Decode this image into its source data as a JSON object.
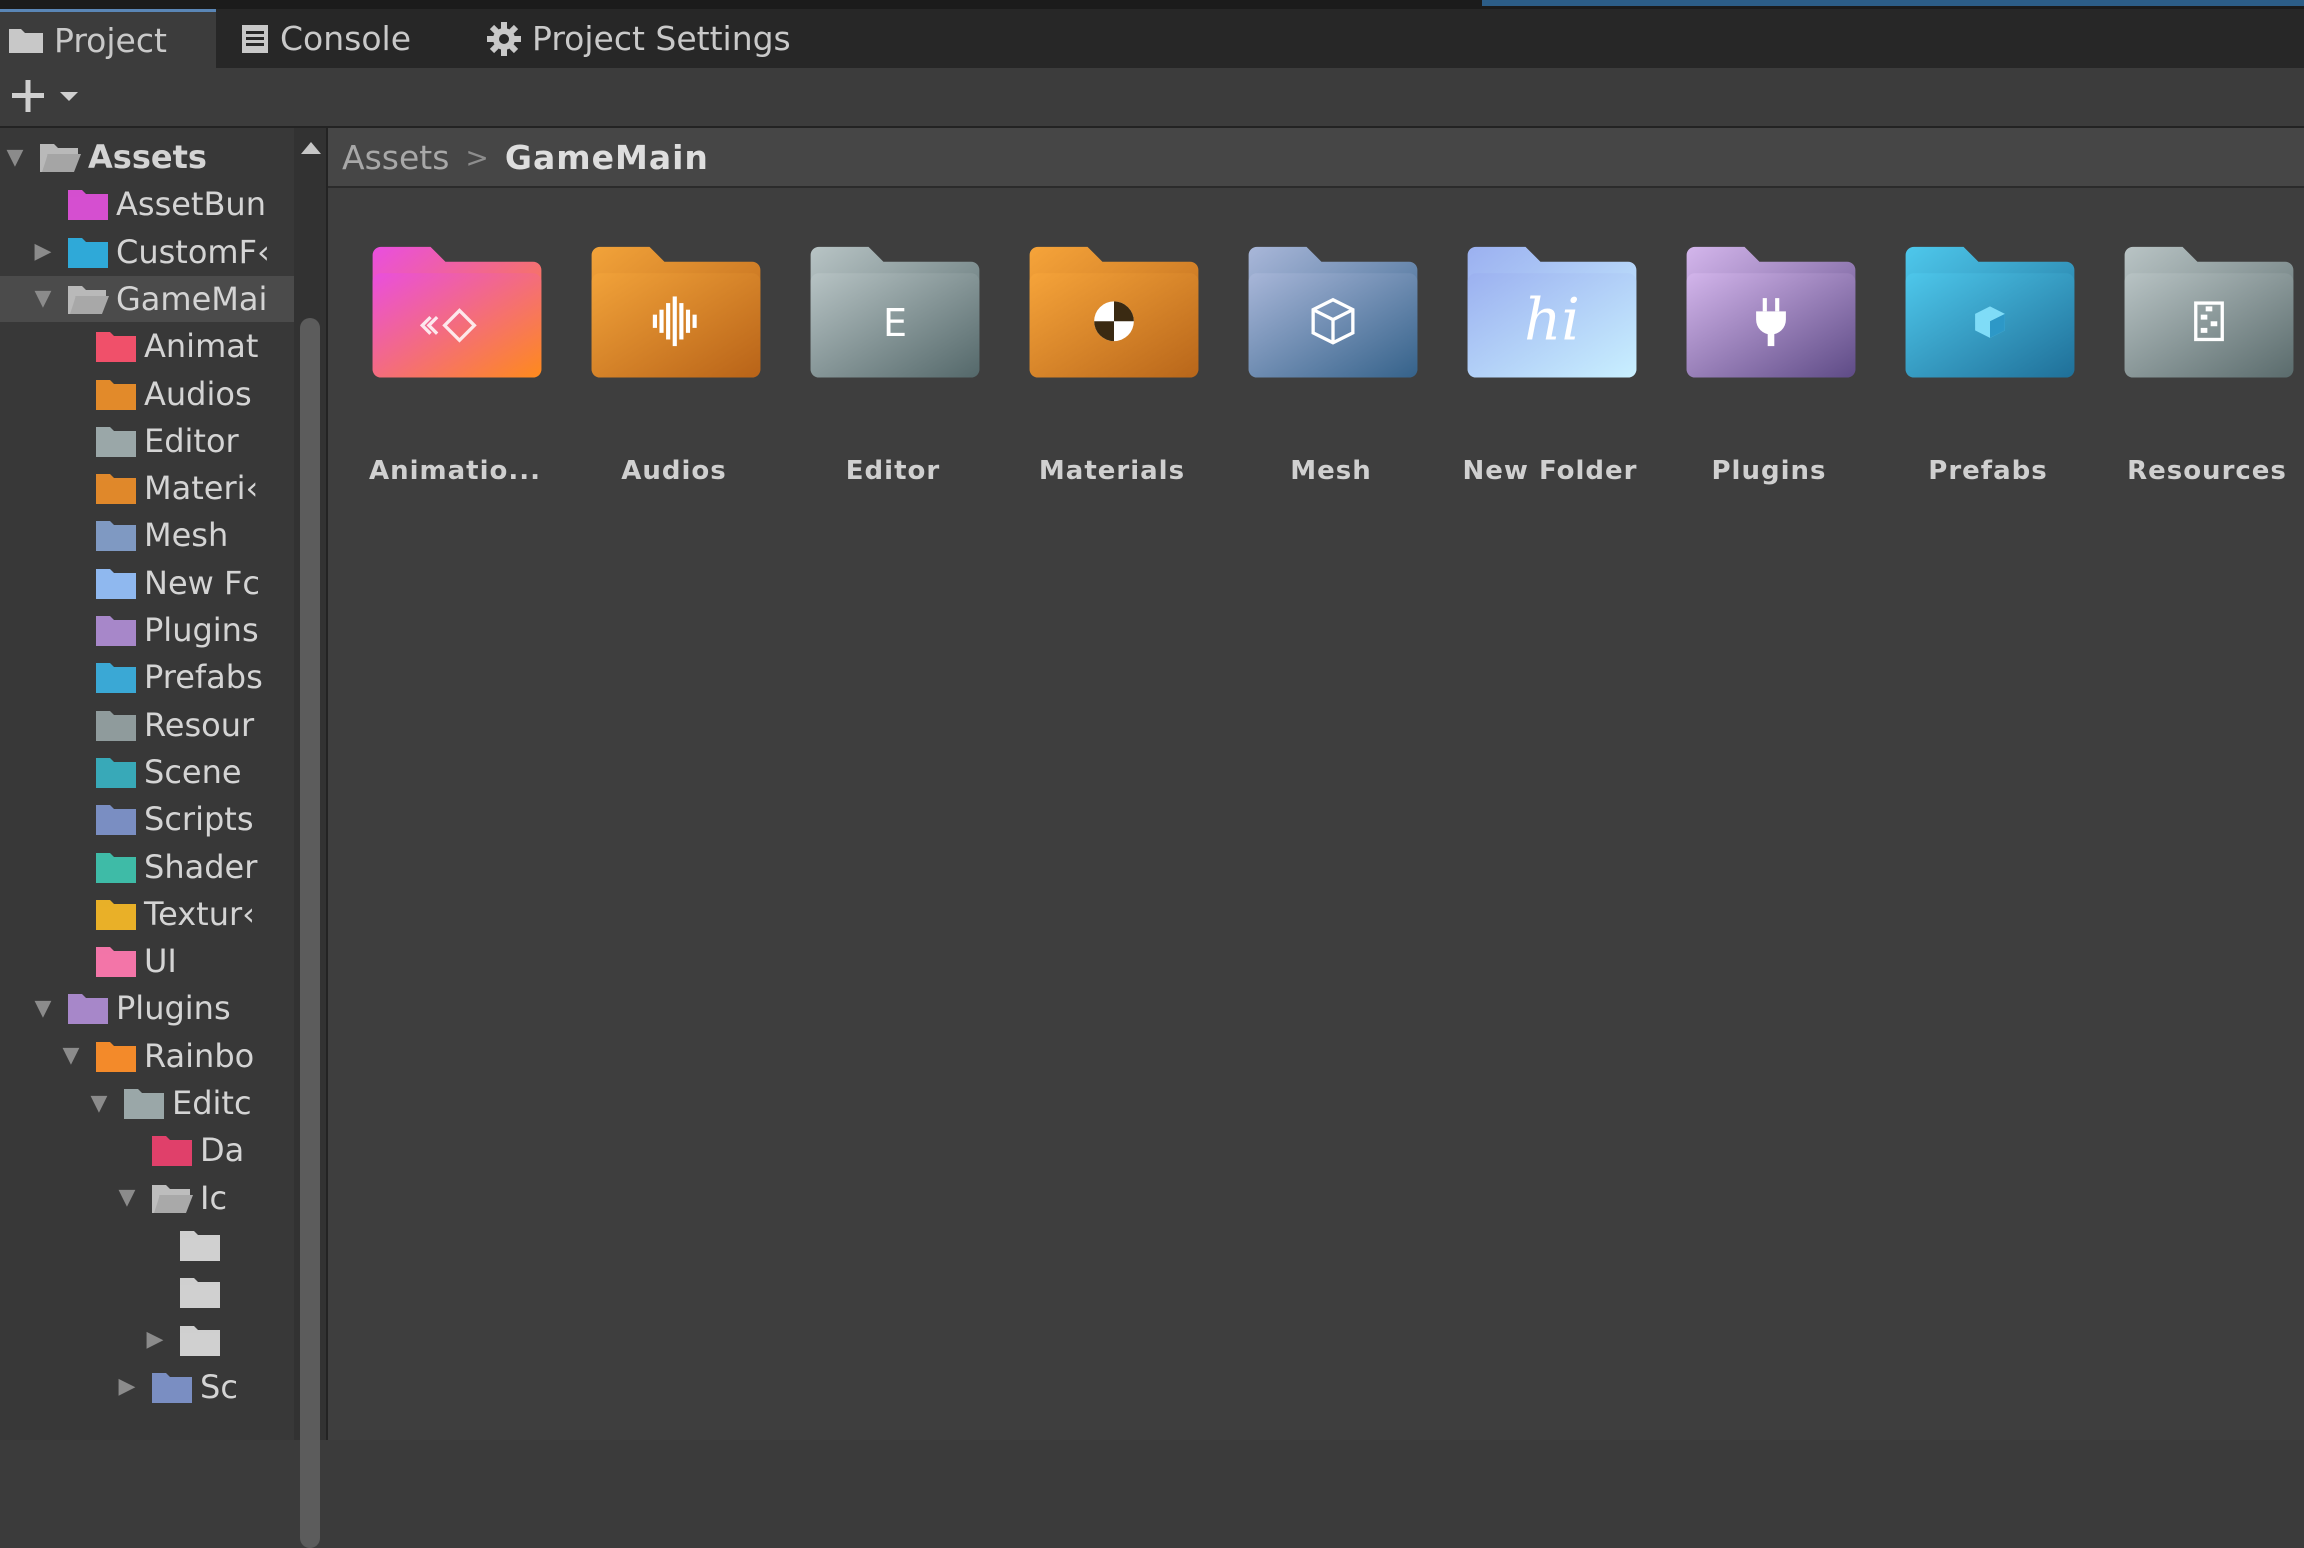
{
  "tabs": [
    {
      "label": "Project",
      "icon": "folder-icon",
      "active": true
    },
    {
      "label": "Console",
      "icon": "console-icon",
      "active": false
    },
    {
      "label": "Project Settings",
      "icon": "gear-icon",
      "active": false
    }
  ],
  "toolbar": {
    "add_icon": "plus-dropdown-icon"
  },
  "tree": {
    "items": [
      {
        "label": "Assets",
        "color": "#b9b9b9"
      },
      {
        "label": "AssetBun",
        "color": "#d44fcf"
      },
      {
        "label": "CustomF‹",
        "color": "#2fa9d8"
      },
      {
        "label": "GameMai",
        "color": "#b9b9b9"
      },
      {
        "label": "Animat",
        "color": "#f0506a"
      },
      {
        "label": "Audios",
        "color": "#e28a2a"
      },
      {
        "label": "Editor",
        "color": "#9aa7a8"
      },
      {
        "label": "Materi‹",
        "color": "#e0882b"
      },
      {
        "label": "Mesh",
        "color": "#7f99c2"
      },
      {
        "label": "New Fc",
        "color": "#8fb8ef"
      },
      {
        "label": "Plugins",
        "color": "#a787c9"
      },
      {
        "label": "Prefabs",
        "color": "#3ba8d4"
      },
      {
        "label": "Resour",
        "color": "#8f9b9c"
      },
      {
        "label": "Scene",
        "color": "#38a9b8"
      },
      {
        "label": "Scripts",
        "color": "#7a8ec2"
      },
      {
        "label": "Shader",
        "color": "#3fbba7"
      },
      {
        "label": "Textur‹",
        "color": "#e8b028"
      },
      {
        "label": "UI",
        "color": "#f275a8"
      },
      {
        "label": "Plugins",
        "color": "#a787c9"
      },
      {
        "label": "Rainbo",
        "color": "#f28a2a"
      },
      {
        "label": "Editc",
        "color": "#9aa7a8"
      },
      {
        "label": "Da",
        "color": "#e0406a"
      },
      {
        "label": "Ic",
        "color": "#bdbdbd"
      },
      {
        "label": "",
        "color": "#cfcfcf"
      },
      {
        "label": "",
        "color": "#cfcfcf"
      },
      {
        "label": "",
        "color": "#cfcfcf"
      },
      {
        "label": "Sc",
        "color": "#7a8ec2"
      }
    ]
  },
  "breadcrumb": {
    "root": "Assets",
    "separator": ">",
    "current": "GameMain"
  },
  "folders": [
    {
      "name": "Animatio...",
      "icon": "animation-icon",
      "colors": [
        "#e94ee0",
        "#fe8a1c"
      ]
    },
    {
      "name": "Audios",
      "icon": "audio-waveform-icon",
      "colors": [
        "#f2a33a",
        "#b86318"
      ]
    },
    {
      "name": "Editor",
      "icon": "editor-letter-e-icon",
      "colors": [
        "#b8c4c5",
        "#54686a"
      ]
    },
    {
      "name": "Materials",
      "icon": "material-ball-icon",
      "colors": [
        "#f6a43a",
        "#b8661a"
      ]
    },
    {
      "name": "Mesh",
      "icon": "mesh-cube-icon",
      "colors": [
        "#a9b7d9",
        "#35628a"
      ]
    },
    {
      "name": "New Folder",
      "icon": "hi-script-icon",
      "colors": [
        "#9bb0f0",
        "#c9f0ff"
      ]
    },
    {
      "name": "Plugins",
      "icon": "plug-icon",
      "colors": [
        "#d4b6ec",
        "#5e4b86"
      ]
    },
    {
      "name": "Prefabs",
      "icon": "prefab-cube-icon",
      "colors": [
        "#4ec8ec",
        "#1f6f98"
      ]
    },
    {
      "name": "Resources",
      "icon": "resources-zip-icon",
      "colors": [
        "#b9c4c5",
        "#5a6b6c"
      ]
    }
  ]
}
